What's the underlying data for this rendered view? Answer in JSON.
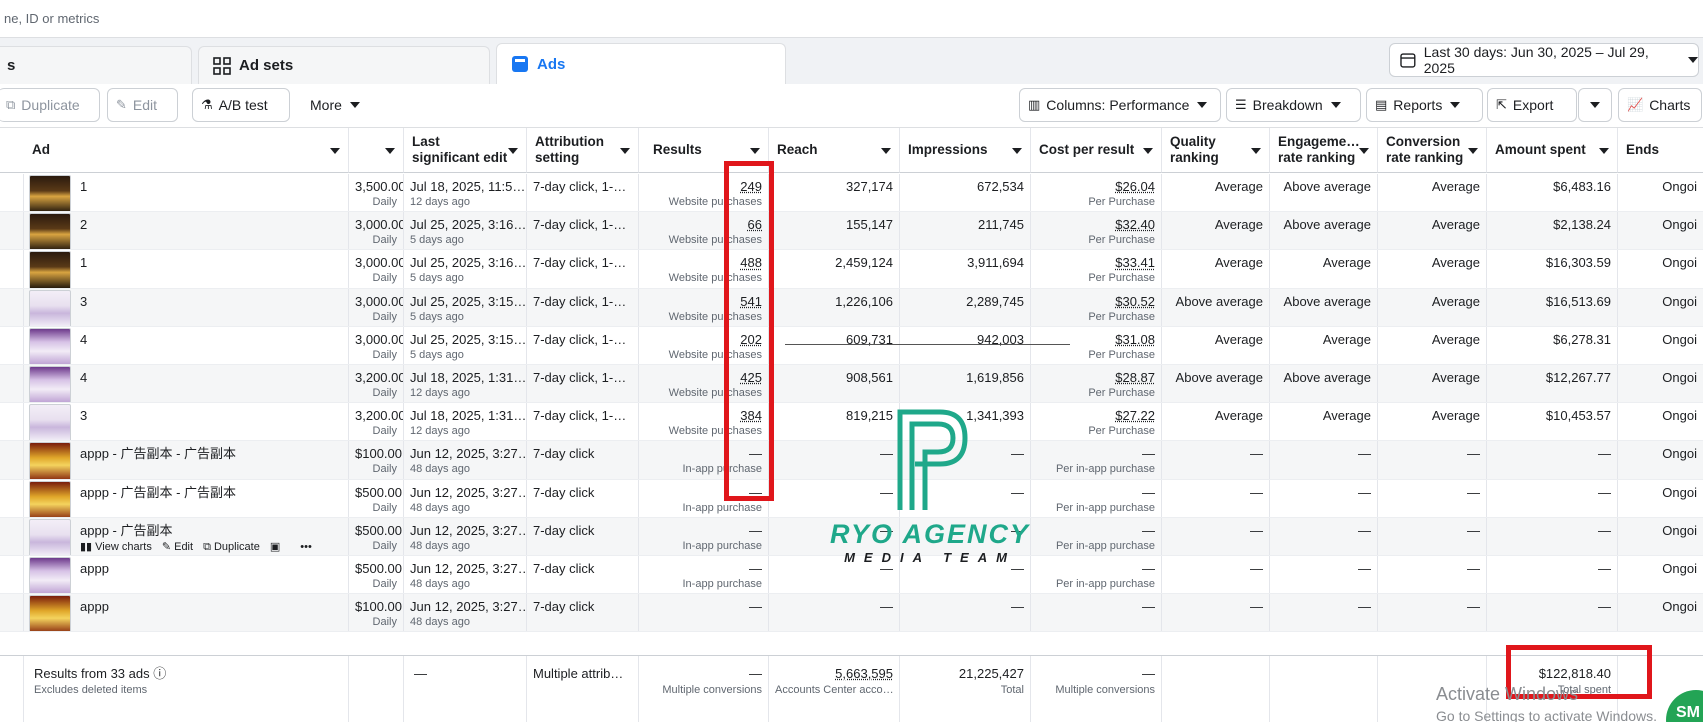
{
  "search": {
    "placeholder": "ne, ID or metrics"
  },
  "tabs": [
    {
      "label": "s"
    },
    {
      "label": "Ad sets"
    },
    {
      "label": "Ads"
    }
  ],
  "date_range": {
    "label": "Last 30 days: Jun 30, 2025 – Jul 29, 2025"
  },
  "toolbar": {
    "duplicate": "Duplicate",
    "edit": "Edit",
    "ab_test": "A/B test",
    "more": "More",
    "columns": "Columns: Performance",
    "breakdown": "Breakdown",
    "reports": "Reports",
    "export": "Export",
    "charts": "Charts"
  },
  "headers": {
    "ad": "Ad",
    "budget": "",
    "last_edit": "Last significant edit",
    "attribution": "Attribution setting",
    "results": "Results",
    "reach": "Reach",
    "impressions": "Impressions",
    "cpr": "Cost per result",
    "quality": "Quality ranking",
    "engagement": "Engageme… rate ranking",
    "conversion": "Conversion rate ranking",
    "amount": "Amount spent",
    "ends": "Ends"
  },
  "rows": [
    {
      "name": "1",
      "budget": "3,500.00",
      "budget_sub": "Daily",
      "edit": "Jul 18, 2025, 11:5…",
      "edit_sub": "12 days ago",
      "attr": "7-day click, 1-…",
      "results": "249",
      "results_sub": "Website purchases",
      "reach": "327,174",
      "impr": "672,534",
      "cpr": "$26.04",
      "cpr_sub": "Per Purchase",
      "quality": "Average",
      "engagement": "Above average",
      "conversion": "Average",
      "amount": "$6,483.16",
      "ends": "Ongoi",
      "thumb": "dark"
    },
    {
      "name": "2",
      "budget": "3,000.00",
      "budget_sub": "Daily",
      "edit": "Jul 25, 2025, 3:16…",
      "edit_sub": "5 days ago",
      "attr": "7-day click, 1-…",
      "results": "66",
      "results_sub": "Website purchases",
      "reach": "155,147",
      "impr": "211,745",
      "cpr": "$32.40",
      "cpr_sub": "Per Purchase",
      "quality": "Average",
      "engagement": "Above average",
      "conversion": "Average",
      "amount": "$2,138.24",
      "ends": "Ongoi",
      "thumb": "dark"
    },
    {
      "name": "1",
      "budget": "3,000.00",
      "budget_sub": "Daily",
      "edit": "Jul 25, 2025, 3:16…",
      "edit_sub": "5 days ago",
      "attr": "7-day click, 1-…",
      "results": "488",
      "results_sub": "Website purchases",
      "reach": "2,459,124",
      "impr": "3,911,694",
      "cpr": "$33.41",
      "cpr_sub": "Per Purchase",
      "quality": "Average",
      "engagement": "Average",
      "conversion": "Average",
      "amount": "$16,303.59",
      "ends": "Ongoi",
      "thumb": "dark"
    },
    {
      "name": "3",
      "budget": "3,000.00",
      "budget_sub": "Daily",
      "edit": "Jul 25, 2025, 3:15…",
      "edit_sub": "5 days ago",
      "attr": "7-day click, 1-…",
      "results": "541",
      "results_sub": "Website purchases",
      "reach": "1,226,106",
      "impr": "2,289,745",
      "cpr": "$30.52",
      "cpr_sub": "Per Purchase",
      "quality": "Above average",
      "engagement": "Above average",
      "conversion": "Average",
      "amount": "$16,513.69",
      "ends": "Ongoi",
      "thumb": "light"
    },
    {
      "name": "4",
      "budget": "3,000.00",
      "budget_sub": "Daily",
      "edit": "Jul 25, 2025, 3:15…",
      "edit_sub": "5 days ago",
      "attr": "7-day click, 1-…",
      "results": "202",
      "results_sub": "Website purchases",
      "reach": "609,731",
      "impr": "942,003",
      "cpr": "$31.08",
      "cpr_sub": "Per Purchase",
      "quality": "Average",
      "engagement": "Average",
      "conversion": "Average",
      "amount": "$6,278.31",
      "ends": "Ongoi",
      "thumb": "purple"
    },
    {
      "name": "4",
      "budget": "3,200.00",
      "budget_sub": "Daily",
      "edit": "Jul 18, 2025, 1:31…",
      "edit_sub": "12 days ago",
      "attr": "7-day click, 1-…",
      "results": "425",
      "results_sub": "Website purchases",
      "reach": "908,561",
      "impr": "1,619,856",
      "cpr": "$28.87",
      "cpr_sub": "Per Purchase",
      "quality": "Above average",
      "engagement": "Above average",
      "conversion": "Average",
      "amount": "$12,267.77",
      "ends": "Ongoi",
      "thumb": "purple"
    },
    {
      "name": "3",
      "budget": "3,200.00",
      "budget_sub": "Daily",
      "edit": "Jul 18, 2025, 1:31…",
      "edit_sub": "12 days ago",
      "attr": "7-day click, 1-…",
      "results": "384",
      "results_sub": "Website purchases",
      "reach": "819,215",
      "impr": "1,341,393",
      "cpr": "$27.22",
      "cpr_sub": "Per Purchase",
      "quality": "Average",
      "engagement": "Average",
      "conversion": "Average",
      "amount": "$10,453.57",
      "ends": "Ongoi",
      "thumb": "light"
    },
    {
      "name": "appp - 广告副本 - 广告副本",
      "budget": "$100.00",
      "budget_sub": "Daily",
      "edit": "Jun 12, 2025, 3:27…",
      "edit_sub": "48 days ago",
      "attr": "7-day click",
      "results": "—",
      "results_sub": "In-app purchase",
      "reach": "—",
      "impr": "—",
      "cpr": "—",
      "cpr_sub": "Per in-app purchase",
      "quality": "—",
      "engagement": "—",
      "conversion": "—",
      "amount": "—",
      "ends": "Ongoi",
      "thumb": "gold"
    },
    {
      "name": "appp - 广告副本 - 广告副本",
      "budget": "$500.00",
      "budget_sub": "Daily",
      "edit": "Jun 12, 2025, 3:27…",
      "edit_sub": "48 days ago",
      "attr": "7-day click",
      "results": "—",
      "results_sub": "In-app purchase",
      "reach": "—",
      "impr": "—",
      "cpr": "—",
      "cpr_sub": "Per in-app purchase",
      "quality": "—",
      "engagement": "—",
      "conversion": "—",
      "amount": "—",
      "ends": "Ongoi",
      "thumb": "gold"
    },
    {
      "name": "appp - 广告副本",
      "budget": "$500.00",
      "budget_sub": "Daily",
      "edit": "Jun 12, 2025, 3:27…",
      "edit_sub": "48 days ago",
      "attr": "7-day click",
      "results": "—",
      "results_sub": "In-app purchase",
      "reach": "—",
      "impr": "—",
      "cpr": "—",
      "cpr_sub": "Per in-app purchase",
      "quality": "—",
      "engagement": "—",
      "conversion": "—",
      "amount": "—",
      "ends": "Ongoi",
      "thumb": "light",
      "actions": true
    },
    {
      "name": "appp",
      "budget": "$500.00",
      "budget_sub": "Daily",
      "edit": "Jun 12, 2025, 3:27…",
      "edit_sub": "48 days ago",
      "attr": "7-day click",
      "results": "—",
      "results_sub": "In-app purchase",
      "reach": "—",
      "impr": "—",
      "cpr": "—",
      "cpr_sub": "Per in-app purchase",
      "quality": "—",
      "engagement": "—",
      "conversion": "—",
      "amount": "—",
      "ends": "Ongoi",
      "thumb": "purple"
    },
    {
      "name": "appp",
      "budget": "$100.00",
      "budget_sub": "Daily",
      "edit": "Jun 12, 2025, 3:27…",
      "edit_sub": "48 days ago",
      "attr": "7-day click",
      "results": "—",
      "results_sub": "",
      "reach": "—",
      "impr": "—",
      "cpr": "—",
      "cpr_sub": "",
      "quality": "—",
      "engagement": "—",
      "conversion": "—",
      "amount": "—",
      "ends": "Ongoi",
      "thumb": "gold"
    }
  ],
  "row_actions": {
    "view_charts": "View charts",
    "edit": "Edit",
    "duplicate": "Duplicate"
  },
  "footer": {
    "label": "Results from 33 ads",
    "sub": "Excludes deleted items",
    "budget": "—",
    "attr": "Multiple attrib…",
    "results": "—",
    "results_sub": "Multiple conversions",
    "reach": "5,663,595",
    "reach_sub": "Accounts Center acco…",
    "impr": "21,225,427",
    "impr_sub": "Total",
    "cpr": "—",
    "cpr_sub": "Multiple conversions",
    "amount": "$122,818.40",
    "amount_sub": "Total spent"
  },
  "watermark": {
    "brand": "RYO AGENCY",
    "tagline": "MEDIA TEAM"
  },
  "windows": {
    "line1": "Activate Windows",
    "line2": "Go to Settings to activate Windows."
  },
  "chat": {
    "label": "SM"
  },
  "colors": {
    "accent": "#1877f2",
    "highlight": "#e0161b",
    "watermark": "#1fa88a"
  }
}
